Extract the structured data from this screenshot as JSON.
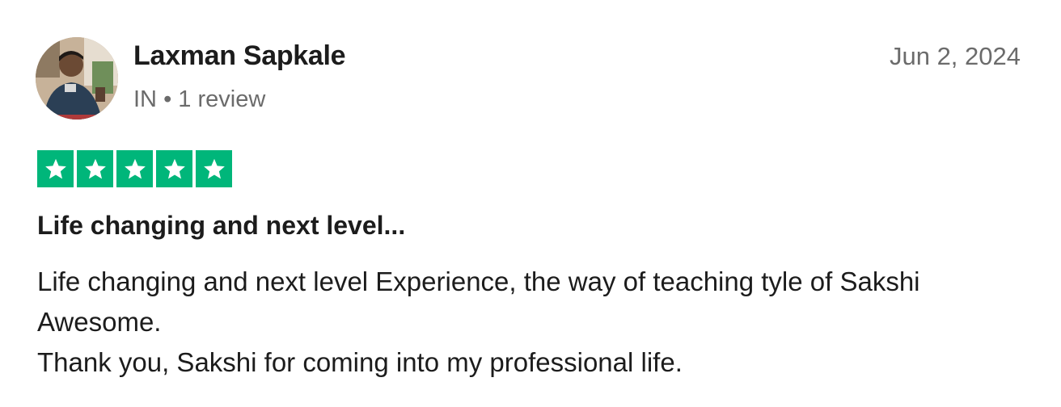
{
  "reviewer": {
    "name": "Laxman Sapkale",
    "country": "IN",
    "separator": "•",
    "review_count": "1 review"
  },
  "review": {
    "date": "Jun 2, 2024",
    "rating": 5,
    "rating_max": 5,
    "star_color": "#00b67a",
    "title": "Life changing and next level...",
    "body_line_1": "Life changing and next level Experience, the way of teaching tyle of Sakshi Awesome.",
    "body_line_2": "Thank you, Sakshi for coming into my professional life."
  },
  "icons": {
    "avatar": "user-photo",
    "star": "star-icon"
  }
}
